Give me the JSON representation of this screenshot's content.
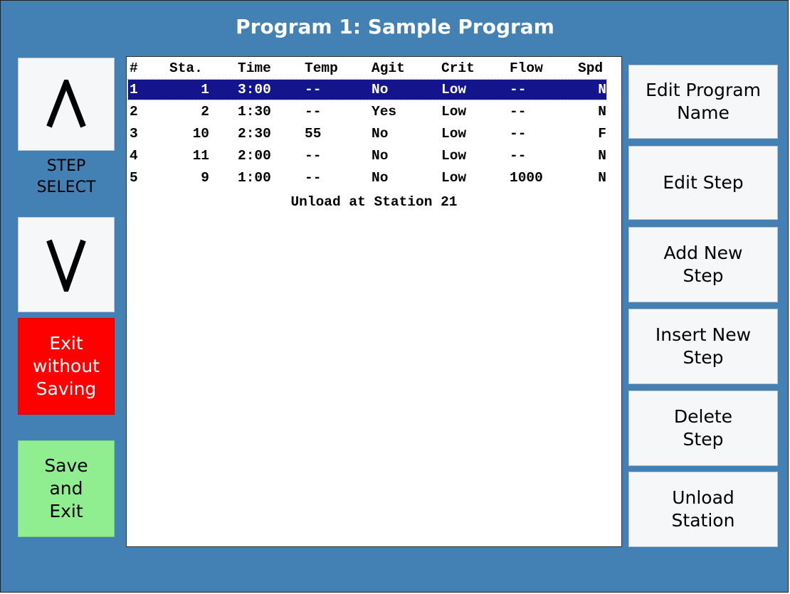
{
  "window": {
    "title": "Program 1: Sample Program"
  },
  "left": {
    "step_select_label": "STEP\nSELECT",
    "up_button_label": "/\\",
    "down_button_label": "V",
    "exit_label": "Exit\nwithout\nSaving",
    "save_label": "Save\nand\nExit"
  },
  "table": {
    "headers": [
      "#",
      "Sta.",
      "Time",
      "Temp",
      "Agit",
      "Crit",
      "Flow",
      "Spd"
    ],
    "rows": [
      [
        "1",
        "1",
        "3:00",
        "--",
        "No",
        "Low",
        "--",
        "N"
      ],
      [
        "2",
        "2",
        "1:30",
        "--",
        "Yes",
        "Low",
        "--",
        "N"
      ],
      [
        "3",
        "10",
        "2:30",
        "55",
        "No",
        "Low",
        "--",
        "F"
      ],
      [
        "4",
        "11",
        "2:00",
        "--",
        "No",
        "Low",
        "--",
        "N"
      ],
      [
        "5",
        "9",
        "1:00",
        "--",
        "No",
        "Low",
        "1000",
        "N"
      ]
    ],
    "selected_row": 0,
    "footer": "Unload at Station 21"
  },
  "right": {
    "buttons": [
      "Edit Program\nName",
      "Edit Step",
      "Add New\nStep",
      "Insert New\nStep",
      "Delete\nStep",
      "Unload\nStation"
    ]
  },
  "colors": {
    "background": "#4381b5",
    "selected_row": "#14148c",
    "exit_button": "#ff0000",
    "save_button": "#90ee90"
  }
}
